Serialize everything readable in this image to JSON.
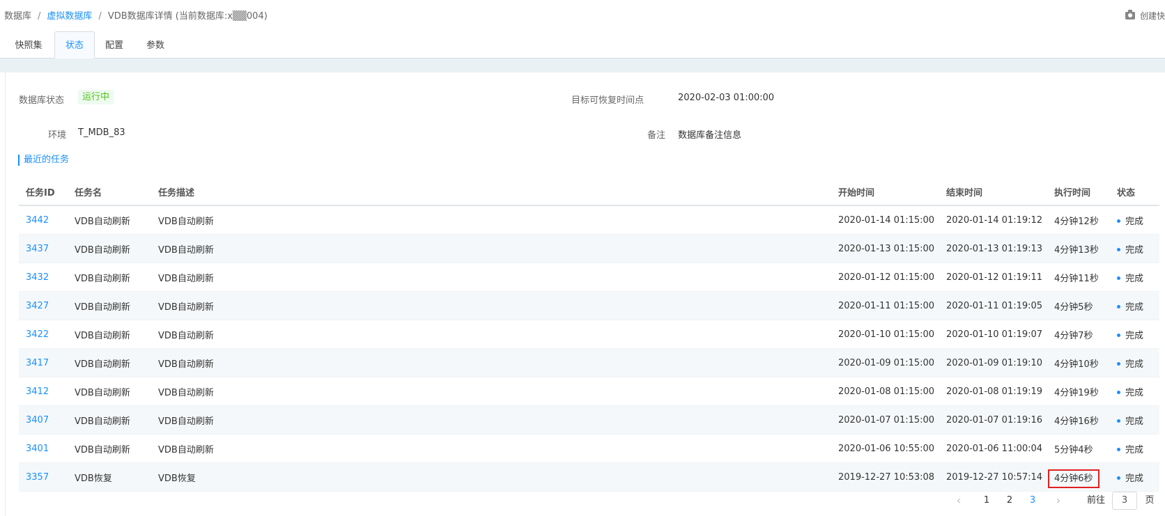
{
  "breadcrumb": {
    "root": "数据库",
    "parent": "虚拟数据库",
    "current": "VDB数据库详情 (当前数据库:x▒▒004)"
  },
  "top_action": {
    "label": "创建快",
    "icon": "camera-icon"
  },
  "tabs": [
    "快照集",
    "状态",
    "配置",
    "参数"
  ],
  "active_tab": "状态",
  "info": {
    "db_status_label": "数据库状态",
    "db_status_value": "运行中",
    "target_time_label": "目标可恢复时间点",
    "target_time_value": "2020-02-03 01:00:00",
    "env_label": "环境",
    "env_value": "T_MDB_83",
    "note_label": "备注",
    "note_value": "数据库备注信息"
  },
  "recent_tasks_title": "最近的任务",
  "table": {
    "headers": [
      "任务ID",
      "任务名",
      "任务描述",
      "开始时间",
      "结束时间",
      "执行时间",
      "状态"
    ],
    "rows": [
      [
        "3442",
        "VDB自动刷新",
        "VDB自动刷新",
        "2020-01-14 01:15:00",
        "2020-01-14 01:19:12",
        "4分钟12秒",
        "完成"
      ],
      [
        "3437",
        "VDB自动刷新",
        "VDB自动刷新",
        "2020-01-13 01:15:00",
        "2020-01-13 01:19:13",
        "4分钟13秒",
        "完成"
      ],
      [
        "3432",
        "VDB自动刷新",
        "VDB自动刷新",
        "2020-01-12 01:15:00",
        "2020-01-12 01:19:11",
        "4分钟11秒",
        "完成"
      ],
      [
        "3427",
        "VDB自动刷新",
        "VDB自动刷新",
        "2020-01-11 01:15:00",
        "2020-01-11 01:19:05",
        "4分钟5秒",
        "完成"
      ],
      [
        "3422",
        "VDB自动刷新",
        "VDB自动刷新",
        "2020-01-10 01:15:00",
        "2020-01-10 01:19:07",
        "4分钟7秒",
        "完成"
      ],
      [
        "3417",
        "VDB自动刷新",
        "VDB自动刷新",
        "2020-01-09 01:15:00",
        "2020-01-09 01:19:10",
        "4分钟10秒",
        "完成"
      ],
      [
        "3412",
        "VDB自动刷新",
        "VDB自动刷新",
        "2020-01-08 01:15:00",
        "2020-01-08 01:19:19",
        "4分钟19秒",
        "完成"
      ],
      [
        "3407",
        "VDB自动刷新",
        "VDB自动刷新",
        "2020-01-07 01:15:00",
        "2020-01-07 01:19:16",
        "4分钟16秒",
        "完成"
      ],
      [
        "3401",
        "VDB自动刷新",
        "VDB自动刷新",
        "2020-01-06 10:55:00",
        "2020-01-06 11:00:04",
        "5分钟4秒",
        "完成"
      ],
      [
        "3357",
        "VDB恢复",
        "VDB恢复",
        "2019-12-27 10:53:08",
        "2019-12-27 10:57:14",
        "4分钟6秒",
        "完成"
      ]
    ],
    "highlighted_cell": "4分钟6秒"
  },
  "pagination": {
    "prev_icon": "chevron-left-icon",
    "next_icon": "chevron-right-icon",
    "pages": [
      "1",
      "2",
      "3"
    ],
    "current_page": "3",
    "goto_label": "前往",
    "goto_value": "3",
    "page_suffix": "页"
  },
  "colors": {
    "accent": "#1890ff",
    "status_running_bg": "#eefaf0",
    "status_running_text": "#52c41a",
    "highlight_box": "#e02020"
  }
}
